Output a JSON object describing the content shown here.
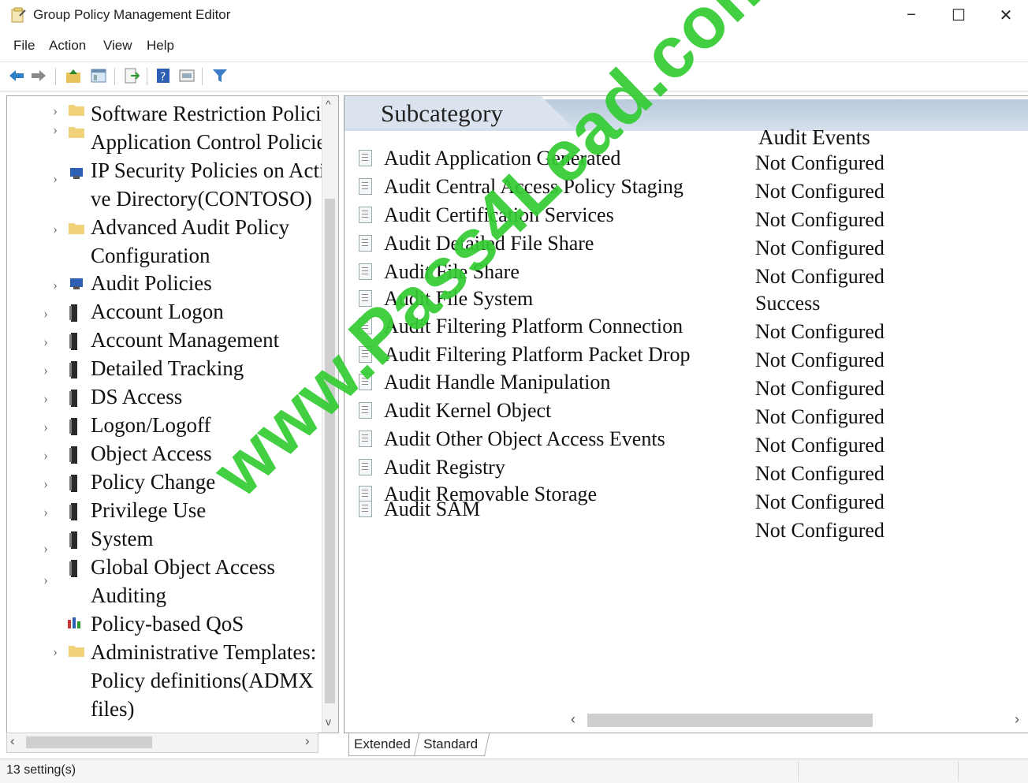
{
  "window": {
    "title": "Group Policy Management Editor",
    "controls": [
      "−",
      "☐",
      "✕"
    ]
  },
  "menu": [
    "File",
    "Action",
    "View",
    "Help"
  ],
  "tree": [
    {
      "label": "Software Restriction Policies",
      "icon": "folder-icon"
    },
    {
      "label": "Application Control Policies",
      "icon": "folder-icon"
    },
    {
      "label": "IP Security Policies on Acti-",
      "icon": "ip-security-icon"
    },
    {
      "label": "ve Directory(CONTOSO)",
      "icon": ""
    },
    {
      "label": "Advanced Audit Policy",
      "icon": "folder-icon"
    },
    {
      "label": "Configuration",
      "icon": ""
    },
    {
      "label": "Audit Policies",
      "icon": "audit-policies-icon"
    },
    {
      "label": "Account Logon",
      "icon": "policy-icon"
    },
    {
      "label": "Account Management",
      "icon": "policy-icon"
    },
    {
      "label": "Detailed Tracking",
      "icon": "policy-icon"
    },
    {
      "label": "DS Access",
      "icon": "policy-icon"
    },
    {
      "label": "Logon/Logoff",
      "icon": "policy-icon"
    },
    {
      "label": "Object Access",
      "icon": "policy-icon"
    },
    {
      "label": "Policy Change",
      "icon": "policy-icon"
    },
    {
      "label": "Privilege Use",
      "icon": "policy-icon"
    },
    {
      "label": "System",
      "icon": "policy-icon"
    },
    {
      "label": "Global Object Access",
      "icon": "policy-icon"
    },
    {
      "label": "Auditing",
      "icon": ""
    },
    {
      "label": "Policy-based QoS",
      "icon": "qos-icon"
    },
    {
      "label": "Administrative Templates:",
      "icon": "folder-icon"
    },
    {
      "label": "Policy definitions(ADMX",
      "icon": ""
    },
    {
      "label": "files)",
      "icon": ""
    }
  ],
  "list": {
    "header_subcategory": "Subcategory",
    "header_audit_events": "Audit Events",
    "rows": [
      {
        "subcategory": "Audit Application Generated",
        "setting": "Not Configured"
      },
      {
        "subcategory": "Audit Central Access Policy Staging",
        "setting": "Not Configured"
      },
      {
        "subcategory": "Audit Certification Services",
        "setting": "Not Configured"
      },
      {
        "subcategory": "Audit Detailed File Share",
        "setting": "Not Configured"
      },
      {
        "subcategory": "Audit File Share",
        "setting": "Not Configured"
      },
      {
        "subcategory": "Audit File System",
        "setting": "Success"
      },
      {
        "subcategory": "Audit Filtering Platform Connection",
        "setting": "Not Configured"
      },
      {
        "subcategory": "Audit Filtering Platform Packet Drop",
        "setting": "Not Configured"
      },
      {
        "subcategory": "Audit Handle Manipulation",
        "setting": "Not Configured"
      },
      {
        "subcategory": "Audit Kernel Object",
        "setting": "Not Configured"
      },
      {
        "subcategory": "Audit Other Object Access Events",
        "setting": "Not Configured"
      },
      {
        "subcategory": "Audit Registry",
        "setting": "Not Configured"
      },
      {
        "subcategory": "Audit Removable Storage",
        "setting": "Not Configured"
      },
      {
        "subcategory": "Audit SAM",
        "setting": "Not Configured"
      }
    ]
  },
  "tabs": [
    "Extended",
    "Standard"
  ],
  "status": "13 setting(s)",
  "watermark": "www.Pass4Lead.com"
}
